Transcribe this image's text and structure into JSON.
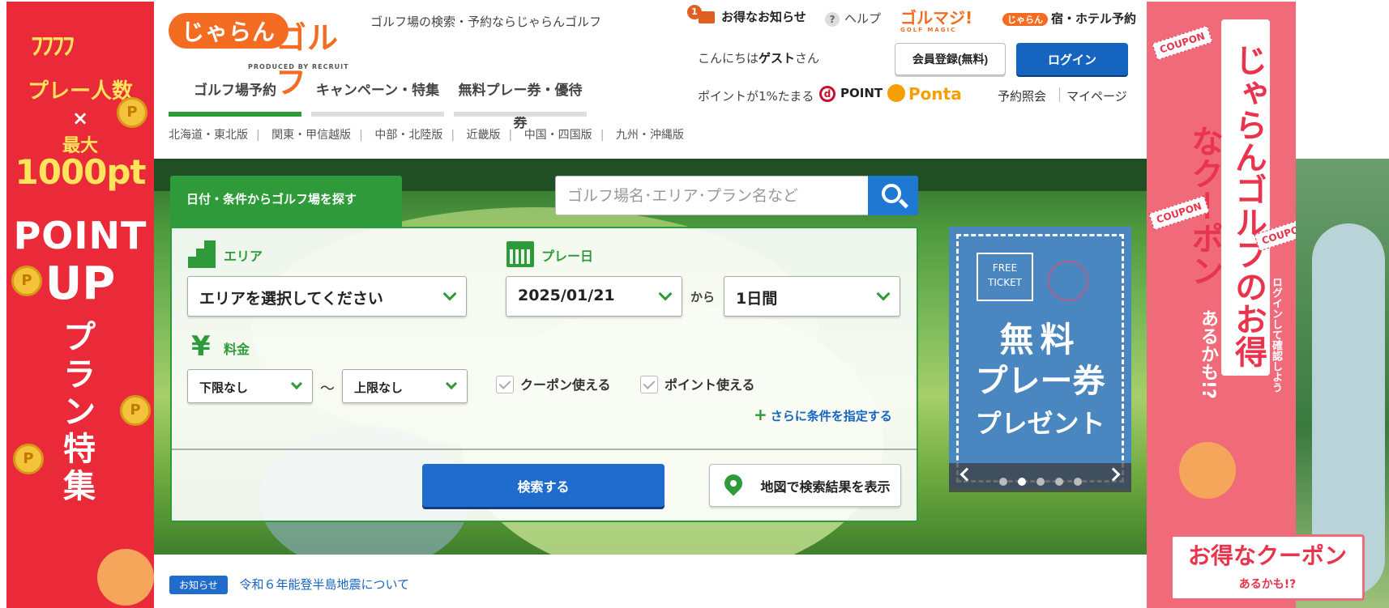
{
  "left_banner": {
    "line1": "プレー人数",
    "line2": "×",
    "line3": "最大",
    "line4": "1000pt",
    "line5": "POINT",
    "line6": "UP",
    "line7": "プラン特集",
    "coin": "P"
  },
  "right_banner": {
    "headline": "じゃらんゴルフのお得なクーポン",
    "sub": "あるかも!?",
    "side": "ログインして確認しよう",
    "tag": "COUPON",
    "bottom_main": "お得なクーポン",
    "bottom_sub": "あるかも!?"
  },
  "header": {
    "logo_jaran": "じゃらん",
    "logo_golf": "ゴルフ",
    "produced_by": "PRODUCED BY RECRUIT",
    "tagline": "ゴルフ場の検索・予約ならじゃらんゴルフ",
    "notice_count": "1",
    "notice_label": "お得なお知らせ",
    "help_label": "ヘルプ",
    "golmaji_label": "ゴルマジ!",
    "golmaji_sub": "GOLF MAGIC",
    "hotel_mini": "じゃらん",
    "hotel_label": "宿・ホテル予約",
    "greeting_prefix": "こんにちは",
    "greeting_name": "ゲスト",
    "greeting_suffix": "さん",
    "register_label": "会員登録(無料)",
    "login_label": "ログイン",
    "points_text": "ポイントが1%たまる",
    "dpoint_label": "POINT",
    "ponta_label": "Ponta",
    "reservation_label": "予約照会",
    "mypage_label": "マイページ"
  },
  "tabs": [
    {
      "label": "ゴルフ場予約",
      "active": true
    },
    {
      "label": "キャンペーン・特集",
      "active": false
    },
    {
      "label": "無料プレー券・優待券",
      "active": false
    }
  ],
  "regions": [
    "北海道・東北版",
    "関東・甲信越版",
    "中部・北陸版",
    "近畿版",
    "中国・四国版",
    "九州・沖縄版"
  ],
  "search": {
    "heading": "日付・条件からゴルフ場を探す",
    "keyword_placeholder": "ゴルフ場名･エリア･プラン名など",
    "area_label": "エリア",
    "area_value": "エリアを選択してください",
    "date_label": "プレー日",
    "date_value": "2025/01/21",
    "from_label": "から",
    "duration_value": "1日間",
    "price_label": "料金",
    "yen": "¥",
    "price_min": "下限なし",
    "tilde": "〜",
    "price_max": "上限なし",
    "coupon_check": "クーポン使える",
    "point_check": "ポイント使える",
    "more_conditions": "さらに条件を指定する",
    "search_button": "検索する",
    "map_button": "地図で検索結果を表示"
  },
  "promo": {
    "ticket": "FREE TICKET",
    "line1": "無料",
    "line2": "プレー券",
    "line3": "プレゼント",
    "active_index": 1,
    "dot_count": 5
  },
  "news": {
    "tag": "お知らせ",
    "link": "令和６年能登半島地震について"
  },
  "colors": {
    "brand_orange": "#f36c21",
    "green": "#2e9a3a",
    "blue": "#1f6ccc",
    "banner_red": "#ea2a38",
    "banner_pink": "#f16a7a"
  }
}
